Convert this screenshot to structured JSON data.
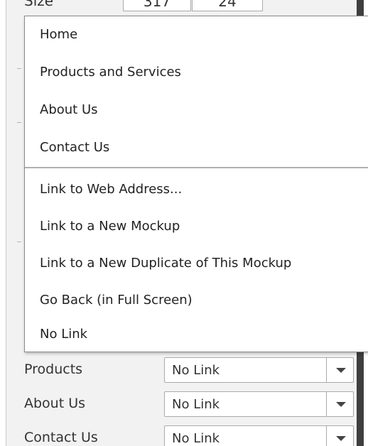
{
  "size_row": {
    "label": "Size",
    "width": "317",
    "height": "24"
  },
  "menu": {
    "pages": [
      "Home",
      "Products and Services",
      "About Us",
      "Contact Us"
    ],
    "actions": [
      "Link to Web Address...",
      "Link to a New Mockup",
      "Link to a New Duplicate of This Mockup",
      "Go Back (in Full Screen)",
      "No Link"
    ]
  },
  "link_rows": [
    {
      "label": "Products",
      "value": "No Link"
    },
    {
      "label": "About Us",
      "value": "No Link"
    },
    {
      "label": "Contact Us",
      "value": "No Link"
    }
  ],
  "colors": {
    "panel_background": "#f2f2f2",
    "menu_background": "#ffffff",
    "right_bar": "#3f3f3f"
  }
}
